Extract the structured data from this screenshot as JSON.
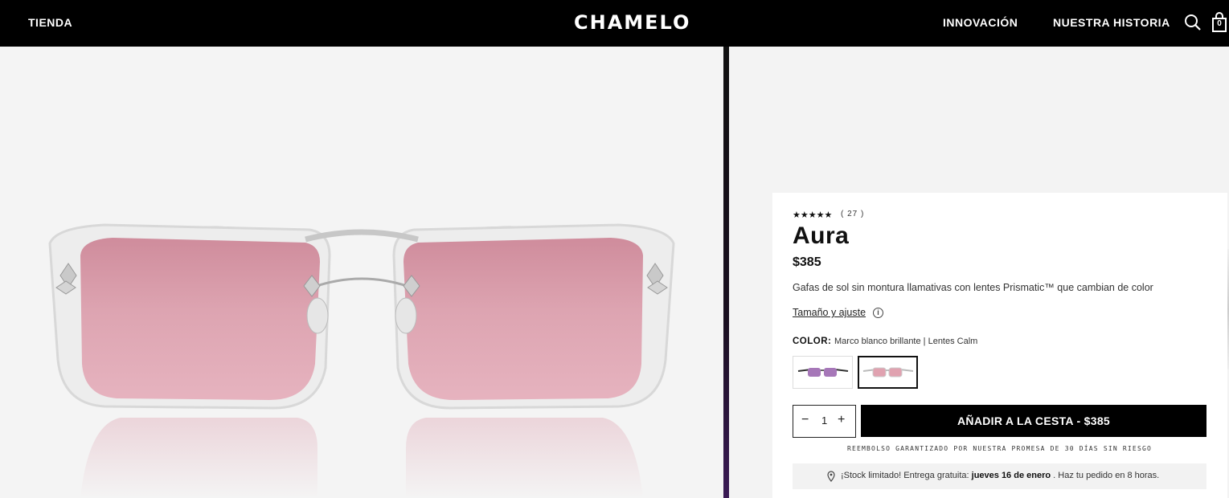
{
  "header": {
    "shop_label": "TIENDA",
    "logo": "CHAMELO",
    "innovation_label": "INNOVACIÓN",
    "story_label": "NUESTRA HISTORIA",
    "search_icon": "search-icon",
    "cart_icon": "shopping-bag-icon",
    "cart_count": "0"
  },
  "product": {
    "stars": "★★★★★",
    "rating_value": 5,
    "review_count": "( 27 )",
    "name": "Aura",
    "price": "$385",
    "description": "Gafas de sol sin montura llamativas con lentes Prismatic™ que cambian de color",
    "size_link": "Tamaño y ajuste",
    "color_label": "COLOR:",
    "color_value": "Marco blanco brillante | Lentes Calm",
    "swatches": [
      {
        "name": "black-frame-purple-lens",
        "selected": false
      },
      {
        "name": "white-frame-pink-lens",
        "selected": true
      }
    ],
    "quantity": "1",
    "qty_minus": "−",
    "qty_plus": "+",
    "add_to_cart": "AÑADIR A LA CESTA - $385",
    "guarantee": "REEMBOLSO GARANTIZADO POR NUESTRA PROMESA DE 30 DÍAS SIN RIESGO",
    "delivery_prefix": "¡Stock limitado! Entrega gratuita: ",
    "delivery_date": "jueves 16 de enero",
    "delivery_suffix": " . Haz tu pedido en 8 horas."
  },
  "colors": {
    "header_bg": "#000000",
    "lens_pink": "#d89aa8",
    "button_bg": "#000000"
  }
}
